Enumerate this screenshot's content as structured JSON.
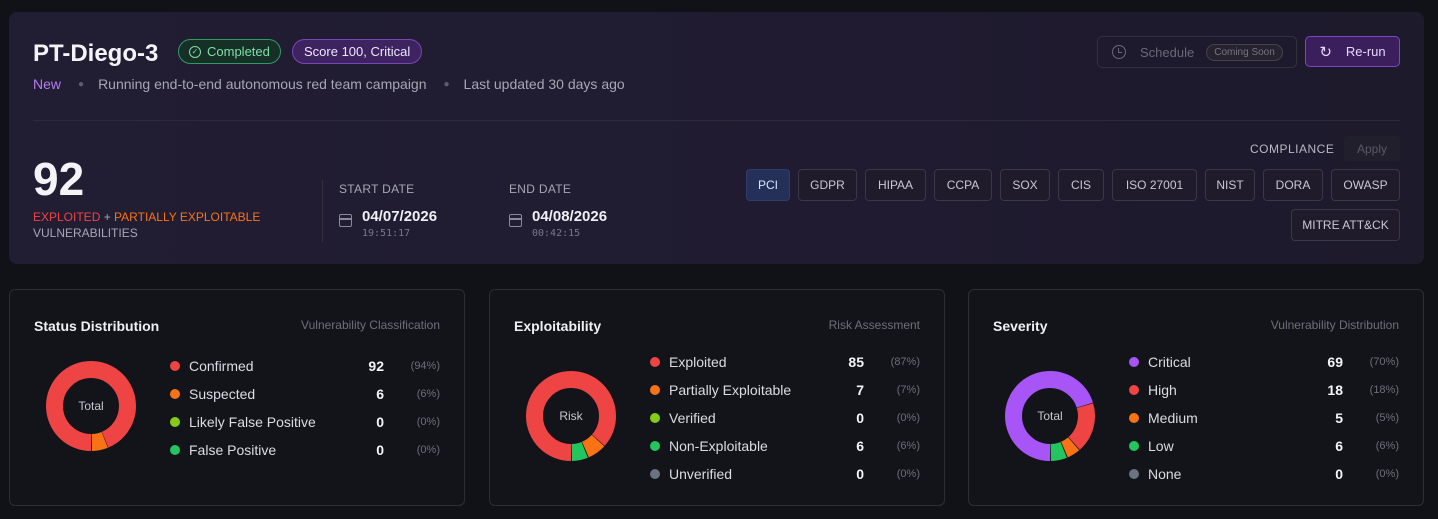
{
  "header": {
    "title": "PT-Diego-3",
    "status_badge": "Completed",
    "score_badge": "Score 100, Critical",
    "tag": "New",
    "description": "Running end-to-end autonomous red team campaign",
    "updated": "Last updated 30 days ago",
    "schedule_label": "Schedule",
    "coming_soon": "Coming Soon",
    "rerun_label": "Re-run"
  },
  "summary": {
    "count": "92",
    "exploited": "EXPLOITED",
    "plus": " + ",
    "partial": "PARTIALLY EXPLOITABLE",
    "vulnerabilities": "VULNERABILITIES",
    "start_label": "START DATE",
    "start_date": "04/07/2026",
    "start_time": "19:51:17",
    "end_label": "END DATE",
    "end_date": "04/08/2026",
    "end_time": "00:42:15"
  },
  "compliance": {
    "label": "COMPLIANCE",
    "apply": "Apply",
    "chips": [
      "PCI",
      "GDPR",
      "HIPAA",
      "CCPA",
      "SOX",
      "CIS",
      "ISO 27001",
      "NIST",
      "DORA",
      "OWASP",
      "MITRE ATT&CK"
    ],
    "active": "PCI"
  },
  "cards": [
    {
      "title": "Status Distribution",
      "subtitle": "Vulnerability Classification",
      "center": "Total",
      "items": [
        {
          "name": "Confirmed",
          "value": "92",
          "pct": "(94%)",
          "color": "#ef4444"
        },
        {
          "name": "Suspected",
          "value": "6",
          "pct": "(6%)",
          "color": "#f97316"
        },
        {
          "name": "Likely False Positive",
          "value": "0",
          "pct": "(0%)",
          "color": "#84cc16"
        },
        {
          "name": "False Positive",
          "value": "0",
          "pct": "(0%)",
          "color": "#22c55e"
        }
      ]
    },
    {
      "title": "Exploitability",
      "subtitle": "Risk Assessment",
      "center": "Risk",
      "items": [
        {
          "name": "Exploited",
          "value": "85",
          "pct": "(87%)",
          "color": "#ef4444"
        },
        {
          "name": "Partially Exploitable",
          "value": "7",
          "pct": "(7%)",
          "color": "#f97316"
        },
        {
          "name": "Verified",
          "value": "0",
          "pct": "(0%)",
          "color": "#84cc16"
        },
        {
          "name": "Non-Exploitable",
          "value": "6",
          "pct": "(6%)",
          "color": "#22c55e"
        },
        {
          "name": "Unverified",
          "value": "0",
          "pct": "(0%)",
          "color": "#6b7280"
        }
      ]
    },
    {
      "title": "Severity",
      "subtitle": "Vulnerability Distribution",
      "center": "Total",
      "items": [
        {
          "name": "Critical",
          "value": "69",
          "pct": "(70%)",
          "color": "#a855f7"
        },
        {
          "name": "High",
          "value": "18",
          "pct": "(18%)",
          "color": "#ef4444"
        },
        {
          "name": "Medium",
          "value": "5",
          "pct": "(5%)",
          "color": "#f97316"
        },
        {
          "name": "Low",
          "value": "6",
          "pct": "(6%)",
          "color": "#22c55e"
        },
        {
          "name": "None",
          "value": "0",
          "pct": "(0%)",
          "color": "#6b7280"
        }
      ]
    }
  ]
}
